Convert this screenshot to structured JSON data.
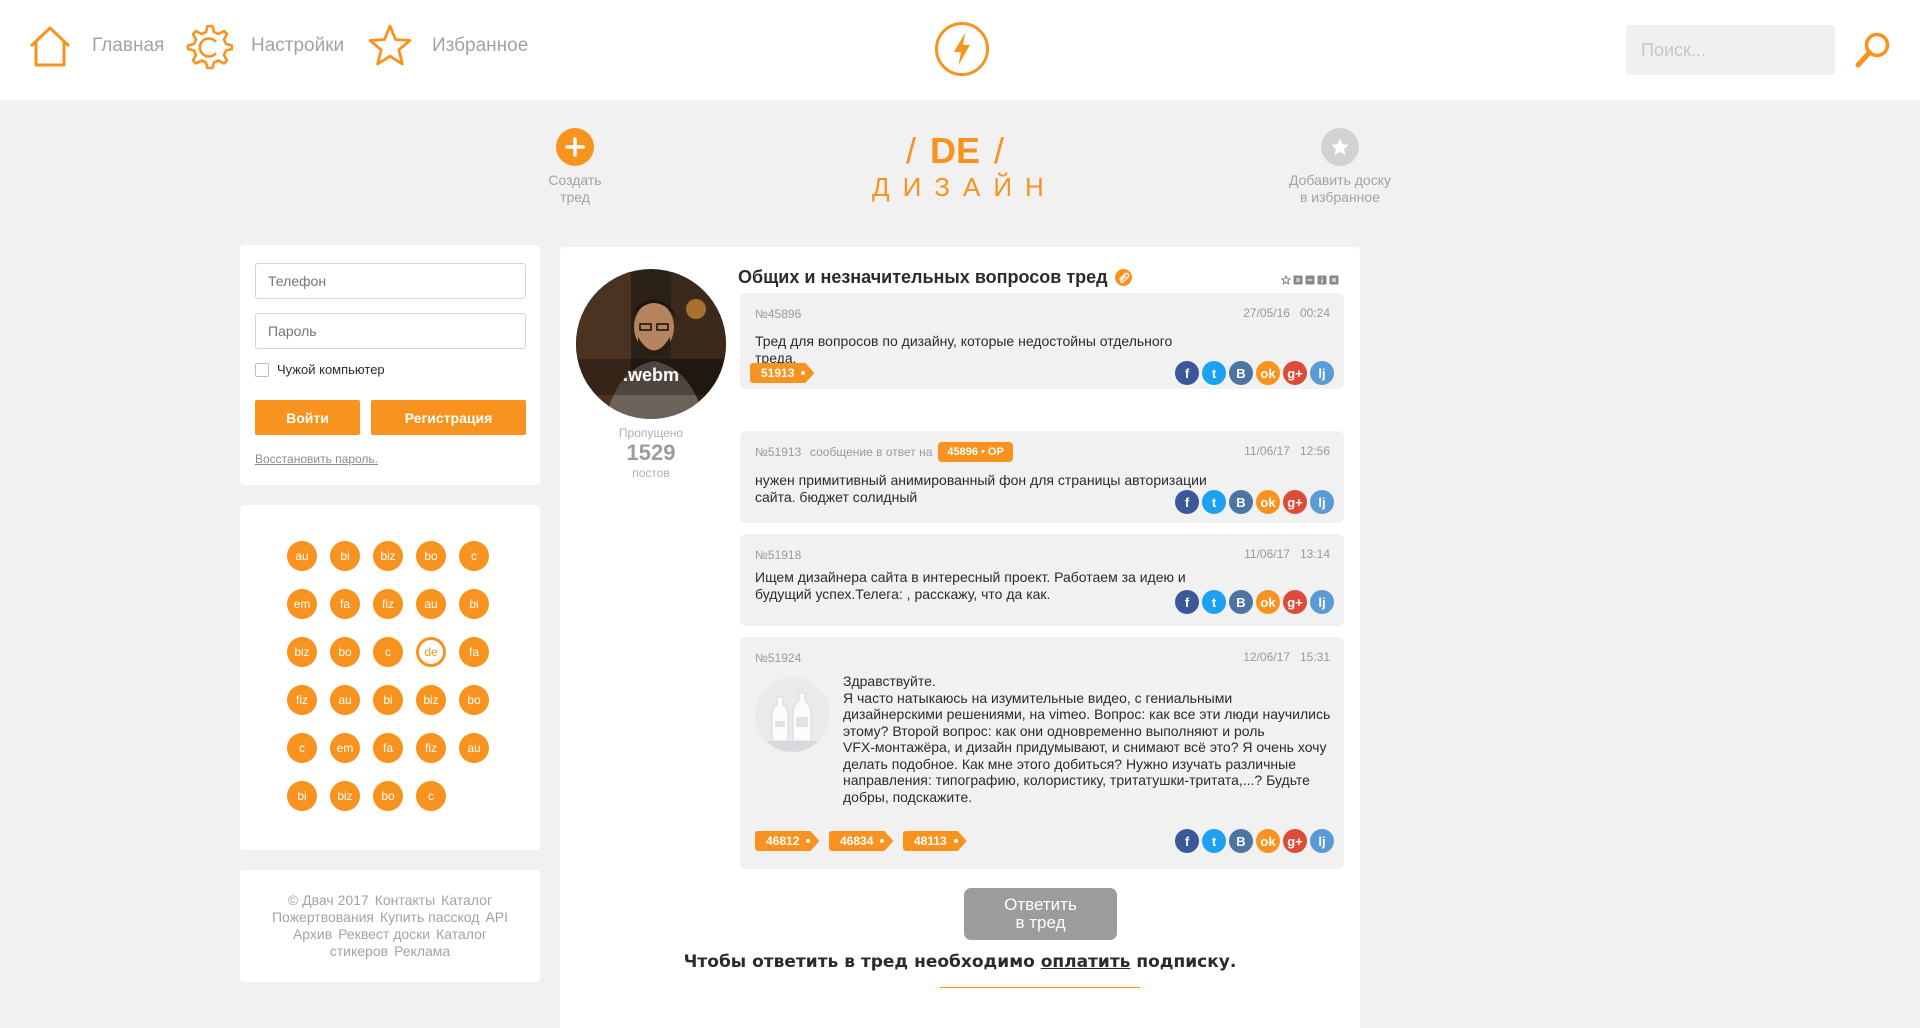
{
  "nav": {
    "home_label": "Главная",
    "settings_label": "Настройки",
    "favorites_label": "Избранное",
    "home_icon": "home-icon",
    "settings_icon": "gear-icon",
    "favorites_icon": "star-icon"
  },
  "logo": {
    "icon": "lightning-bolt-icon"
  },
  "search": {
    "placeholder": "Поиск...",
    "value": "",
    "icon": "search-icon"
  },
  "board_header": {
    "create_label_1": "Создать",
    "create_label_2": "тред",
    "slash": "/",
    "code": "DE",
    "name": "ДИЗАЙН",
    "fav_label_1": "Добавить доску",
    "fav_label_2": "в избранное"
  },
  "login": {
    "phone_placeholder": "Телефон",
    "password_placeholder": "Пароль",
    "remember_label": "Чужой компьютер",
    "remember_checked": false,
    "login_button": "Войти",
    "register_button": "Регистрация",
    "restore_link": "Восстановить пароль."
  },
  "boards": [
    {
      "code": "au",
      "active": false
    },
    {
      "code": "bi",
      "active": false
    },
    {
      "code": "biz",
      "active": false
    },
    {
      "code": "bo",
      "active": false
    },
    {
      "code": "c",
      "active": false
    },
    {
      "code": "em",
      "active": false
    },
    {
      "code": "fa",
      "active": false
    },
    {
      "code": "fiz",
      "active": false
    },
    {
      "code": "au",
      "active": false
    },
    {
      "code": "bi",
      "active": false
    },
    {
      "code": "biz",
      "active": false
    },
    {
      "code": "bo",
      "active": false
    },
    {
      "code": "c",
      "active": false
    },
    {
      "code": "de",
      "active": true
    },
    {
      "code": "fa",
      "active": false
    },
    {
      "code": "fiz",
      "active": false
    },
    {
      "code": "au",
      "active": false
    },
    {
      "code": "bi",
      "active": false
    },
    {
      "code": "biz",
      "active": false
    },
    {
      "code": "bo",
      "active": false
    },
    {
      "code": "c",
      "active": false
    },
    {
      "code": "em",
      "active": false
    },
    {
      "code": "fa",
      "active": false
    },
    {
      "code": "fiz",
      "active": false
    },
    {
      "code": "au",
      "active": false
    },
    {
      "code": "bi",
      "active": false
    },
    {
      "code": "biz",
      "active": false
    },
    {
      "code": "bo",
      "active": false
    },
    {
      "code": "c",
      "active": false
    }
  ],
  "footer": {
    "line1": [
      "© Двач 2017",
      "Контакты",
      "Каталог"
    ],
    "line2": [
      "Пожертвования",
      "Купить пасскод",
      "API"
    ],
    "line3": [
      "Архив",
      "Реквест доски",
      "Каталог"
    ],
    "line4": [
      "стикеров",
      "Реклама"
    ]
  },
  "thread": {
    "title": "Общих и незначительных вопросов тред",
    "op_media_label": ".webm",
    "skipped_label": "Пропущено",
    "skipped_count": "1529",
    "skipped_unit": "постов",
    "tool_icons": [
      "star-icon",
      "number-icon",
      "minus-icon",
      "info-icon",
      "close-icon"
    ]
  },
  "posts": [
    {
      "num": "№45896",
      "date": "27/05/16",
      "time": "00:24",
      "text": [
        "Тред для вопросов по дизайну, которые недостойны отдельного",
        "треда."
      ],
      "replies": [
        "51913"
      ]
    },
    {
      "num": "№51913",
      "reply_prefix": "сообщение в ответ на",
      "reply_to": "45896 • OP",
      "date": "11/06/17",
      "time": "12:56",
      "text": [
        "нужен примитивный анимированный фон для страницы авторизации",
        "сайта. бюджет солидный"
      ],
      "replies": []
    },
    {
      "num": "№51918",
      "date": "11/06/17",
      "time": "13:14",
      "text": [
        "Ищем дизайнера сайта в интересный проект. Работаем за идею и",
        "будущий успех.Телега: , расскажу, что да как."
      ],
      "replies": []
    },
    {
      "num": "№51924",
      "date": "12/06/17",
      "time": "15:31",
      "text": [
        "Здравствуйте.",
        "Я часто натыкаюсь на изумительные видео, с гениальными",
        "дизайнерскими решениями, на vimeo. Вопрос: как все эти люди научились",
        "этому? Второй вопрос: как они одновременно выполняют и роль",
        "VFX-монтажёра, и дизайн придумывают, и снимают всё это? Я очень хочу",
        "делать подобное. Как мне этого добиться? Нужно изучать различные",
        "направления: типографию, колористику, тритатушки-тритата,...? Будьте",
        "добры, подскажите."
      ],
      "replies": [
        "46812",
        "46834",
        "48113"
      ]
    }
  ],
  "share_buttons": [
    {
      "label": "f",
      "icon": "facebook-icon",
      "color": "#3b5998"
    },
    {
      "label": "t",
      "icon": "twitter-icon",
      "color": "#1da1f2"
    },
    {
      "label": "B",
      "icon": "vk-icon",
      "color": "#4c75a3"
    },
    {
      "label": "ok",
      "icon": "odnoklassniki-icon",
      "color": "#f7931e"
    },
    {
      "label": "g+",
      "icon": "google-plus-icon",
      "color": "#dd4b39"
    },
    {
      "label": "lj",
      "icon": "livejournal-icon",
      "color": "#5b9bd5"
    }
  ],
  "reply": {
    "button_line1": "Ответить",
    "button_line2": "в тред",
    "note_prefix": "Чтобы ответить в тред необходимо",
    "note_link": "оплатить",
    "note_suffix": "подписку."
  },
  "colors": {
    "accent": "#f7931e",
    "page_bg": "#f1f1f1",
    "muted": "#a3a3a3"
  }
}
